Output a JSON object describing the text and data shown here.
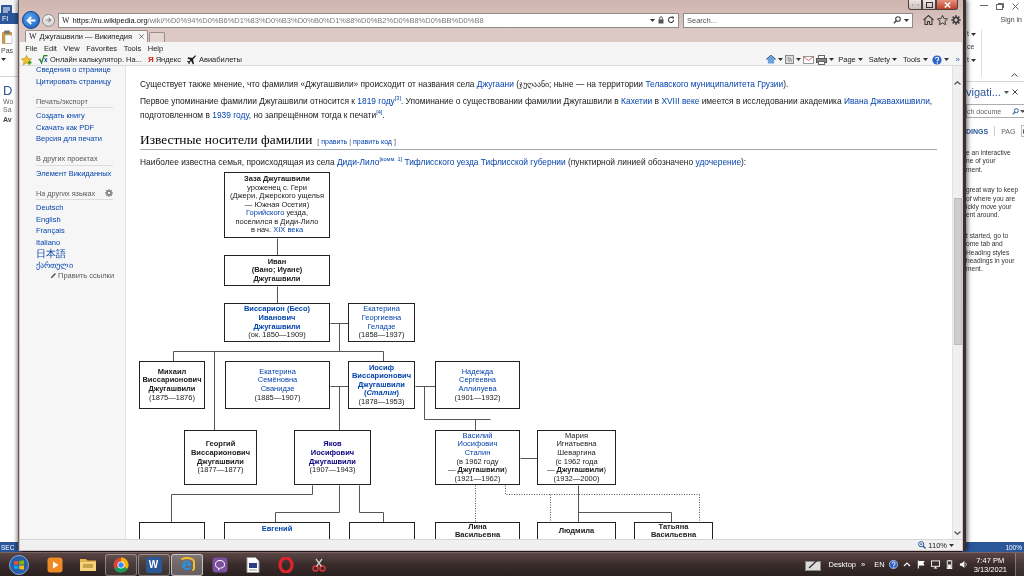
{
  "background_windows": {
    "left": {
      "file_tab": "FI",
      "paste_label": "Pas",
      "pane_title": "D",
      "lines": [
        "Wo",
        "Sa"
      ],
      "bold_line": "Av",
      "status": "SEC"
    },
    "right": {
      "sign_in": "Sign in",
      "ribbon_items": [
        {
          "label": "t",
          "dropdown": true
        },
        {
          "label": "ce",
          "dropdown": false
        },
        {
          "label": "t",
          "dropdown": true
        }
      ],
      "pane_title": "vigati...",
      "search_placeholder": "ch docume",
      "tabs": [
        {
          "label": "DINGS",
          "selected": true
        },
        {
          "label": "PAG",
          "selected": false
        }
      ],
      "help_paragraphs": [
        [
          "e an interactive",
          "ne of your",
          "ment."
        ],
        [
          "great way to keep",
          "of where you are",
          "ickly move your",
          "ent around."
        ],
        [
          "t started, go to",
          "ome tab and",
          "Heading styles",
          "headings in your",
          "ment."
        ]
      ],
      "zoom": "100%"
    }
  },
  "browser": {
    "address": {
      "favicon": "W",
      "host": "https://ru.wikipedia.org",
      "path": "/wiki/%D0%94%D0%B6%D1%83%D0%B3%D0%B0%D1%88%D0%B2%D0%B8%D0%BB%D0%B8"
    },
    "search": {
      "placeholder": "Search..."
    },
    "tabs": [
      {
        "favicon": "W",
        "title": "Джугашвили — Википедия",
        "selected": true
      }
    ],
    "menu": [
      "File",
      "Edit",
      "View",
      "Favorites",
      "Tools",
      "Help"
    ],
    "favorites": [
      {
        "label": "Онлайн калькулятор. На...",
        "kind": "math"
      },
      {
        "label": "Яндекс",
        "kind": "letter",
        "icon_text": "Я"
      },
      {
        "label": "Авиабилеты",
        "kind": "plane"
      }
    ],
    "command_menus": [
      "Page",
      "Safety",
      "Tools"
    ],
    "chevron": "»",
    "zoom": "110%"
  },
  "sidebar": {
    "sections": [
      {
        "items": [
          "Сведения о странице",
          "Цитировать страницу"
        ]
      },
      {
        "heading": "Печать/экспорт",
        "items": [
          "Создать книгу",
          "Скачать как PDF",
          "Версия для печати"
        ]
      },
      {
        "heading": "В других проектах",
        "items": [
          "Элемент Викиданных"
        ]
      },
      {
        "heading": "На других языках",
        "settings": true,
        "items": [
          "Deutsch",
          "English",
          "Français",
          "Italiano",
          "日本語",
          "ქართული"
        ],
        "edit_link": "Править ссылки"
      }
    ]
  },
  "article": {
    "paragraphs": [
      [
        {
          "text": "Существует также мнение, что фамилия «Джугашвили» происходит от названия села ",
          "kind": "text"
        },
        {
          "text": "Джугаани",
          "kind": "link"
        },
        {
          "text": " (ჯუღაანი; ныне — на территории ",
          "kind": "text"
        },
        {
          "text": "Телавского муниципалитета Грузии",
          "kind": "link"
        },
        {
          "text": ").",
          "kind": "text"
        }
      ],
      [
        {
          "text": "Первое упоминание фамилии Джугашвили относится к ",
          "kind": "text"
        },
        {
          "text": "1819 году",
          "kind": "link"
        },
        {
          "text": "[3]",
          "kind": "ref"
        },
        {
          "text": ". Упоминание о существовании фамилии Джугашвили в ",
          "kind": "text"
        },
        {
          "text": "Кахетии",
          "kind": "link"
        },
        {
          "text": " в ",
          "kind": "text"
        },
        {
          "text": "XVIII веке",
          "kind": "link"
        },
        {
          "text": " имеется в исследовании академика ",
          "kind": "text"
        },
        {
          "text": "Ивана Джавахишвили",
          "kind": "link"
        },
        {
          "text": ", подготовленном в ",
          "kind": "text"
        },
        {
          "text": "1939 году",
          "kind": "link"
        },
        {
          "text": ", но запрещённом тогда к печати",
          "kind": "text"
        },
        {
          "text": "[4]",
          "kind": "ref"
        },
        {
          "text": ".",
          "kind": "text"
        }
      ]
    ],
    "section_heading": {
      "title": "Известные носители фамилии",
      "edit_links": [
        {
          "text": "[ ",
          "kind": "text"
        },
        {
          "text": "править",
          "kind": "link"
        },
        {
          "text": " | ",
          "kind": "text"
        },
        {
          "text": "править код",
          "kind": "link"
        },
        {
          "text": " ]",
          "kind": "text"
        }
      ]
    },
    "intro": [
      {
        "text": "Наиболее известна семья, происходящая из села ",
        "kind": "text"
      },
      {
        "text": "Диди-Лило",
        "kind": "link"
      },
      {
        "text": "[комм. 1]",
        "kind": "ref"
      },
      {
        "text": " Тифлисского уезда",
        "kind": "link"
      },
      {
        "text": " Тифлисской губернии",
        "kind": "link"
      },
      {
        "text": " (пунктирной линией обозначено ",
        "kind": "text"
      },
      {
        "text": "удочерение",
        "kind": "link"
      },
      {
        "text": "):",
        "kind": "text"
      }
    ],
    "family_tree": {
      "nodes": [
        {
          "kind": "plain",
          "name": [
            "Заза Джугашвили"
          ],
          "bold": true,
          "details": [
            "уроженец с. Гери",
            "(Джери, Джерского ущелья",
            "— Южная Осетия)",
            [
              {
                "text": "Горийского",
                "kind": "link"
              },
              {
                "text": " уезда,",
                "kind": "text"
              }
            ],
            "поселился в Диди-Лило",
            [
              {
                "text": "в нач. ",
                "kind": "text"
              },
              {
                "text": "XIX века",
                "kind": "link"
              }
            ]
          ]
        },
        {
          "kind": "plain",
          "name": [
            "Иван",
            "(Вано; Иуане)",
            "Джугашвили"
          ],
          "bold": true
        },
        {
          "kind": "link",
          "name": [
            "Виссарион (Бесо)",
            "Иванович",
            "Джугашвили"
          ],
          "bold": true,
          "details": [
            "(ок. 1850—1909)"
          ]
        },
        {
          "kind": "link",
          "name": [
            "Екатерина",
            "Георгиевна",
            "Геладзе"
          ],
          "bold": false,
          "details": [
            "(1858—1937)"
          ]
        },
        {
          "kind": "plain",
          "name": [
            "Михаил",
            "Виссарионович",
            "Джугашвили"
          ],
          "bold": true,
          "details": [
            "(1875—1876)"
          ]
        },
        {
          "kind": "link",
          "name": [
            "Екатерина",
            "Семёновна",
            "Сванидзе"
          ],
          "bold": false,
          "details": [
            "(1885—1907)"
          ]
        },
        {
          "kind": "link",
          "name": [
            "Иосиф",
            "Виссарионович",
            "Джугашвили",
            "(*Сталин*)"
          ],
          "bold": true,
          "details": [
            "(1878—1953)"
          ]
        },
        {
          "kind": "link",
          "name": [
            "Надежда",
            "Сергеевна",
            "Аллилуева"
          ],
          "bold": false,
          "details": [
            "(1901—1932)"
          ]
        },
        {
          "kind": "plain",
          "name": [
            "Георгий",
            "Виссарионович",
            "Джугашвили"
          ],
          "bold": true,
          "details": [
            "(1877—1877)"
          ]
        },
        {
          "kind": "visited",
          "name": [
            "Яков",
            "Иосифович",
            "Джугашвили"
          ],
          "bold": true,
          "details": [
            "(1907—1943)"
          ]
        },
        {
          "kind": "link",
          "name": [
            "Василий",
            "Иосифович",
            "Сталин"
          ],
          "bold": false,
          "details": [
            "(в 1962 году",
            "— **Джугашвили**)",
            "(1921—1962)"
          ]
        },
        {
          "kind": "plain",
          "name": [
            "Мария",
            "Игнатьевна",
            "Шеваргина"
          ],
          "bold": false,
          "details": [
            "(с 1962 года",
            "— **Джугашвили**)",
            "(1932—2000)"
          ]
        },
        {
          "kind": "blank"
        },
        {
          "kind": "link",
          "name": [
            "Евгений"
          ],
          "bold": true
        },
        {
          "kind": "blank"
        },
        {
          "kind": "plain",
          "name": [
            "Лина",
            "Васильевна"
          ],
          "bold": true
        },
        {
          "kind": "plain",
          "name": [
            "Людмила"
          ],
          "bold": true
        },
        {
          "kind": "plain",
          "name": [
            "Татьяна",
            "Васильевна"
          ],
          "bold": true
        }
      ]
    }
  },
  "taskbar": {
    "apps": [
      {
        "kind": "play",
        "running": false,
        "selected": false
      },
      {
        "kind": "folder",
        "running": false,
        "selected": false
      },
      {
        "kind": "wheel",
        "running": true,
        "selected": false
      },
      {
        "kind": "letter-tile",
        "glyph": "W",
        "running": true,
        "selected": false
      },
      {
        "kind": "letter-ring",
        "glyph": "e",
        "running": true,
        "selected": true
      },
      {
        "kind": "bubble",
        "running": false,
        "selected": false
      },
      {
        "kind": "document",
        "running": false,
        "selected": false
      },
      {
        "kind": "ring",
        "running": false,
        "selected": false
      },
      {
        "kind": "scissors",
        "running": false,
        "selected": false
      }
    ],
    "toolbar_label": "Desktop",
    "toolbar_chevron": "»",
    "language": "EN",
    "time": "7:47 PM",
    "date": "3/13/2021"
  }
}
